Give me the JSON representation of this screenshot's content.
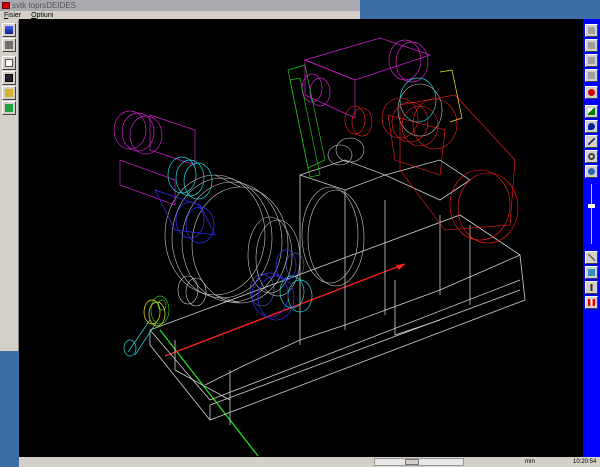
{
  "window": {
    "title": "svtk toprsDEIDES"
  },
  "menu": {
    "items": [
      "Fisier",
      "Optiuni"
    ]
  },
  "left_toolbar": {
    "buttons": [
      "view-icon",
      "shape-icon",
      "new-file-icon",
      "save-icon",
      "open-folder-icon",
      "exit-icon"
    ]
  },
  "right_toolbar": {
    "buttons": [
      "blank",
      "blank",
      "blank",
      "blank",
      "stop-icon",
      "graph-icon",
      "ink-drop-icon",
      "pen-icon",
      "zoom-icon",
      "rotate-icon",
      "check-icon",
      "brush-icon",
      "info-icon",
      "color-icon"
    ]
  },
  "status": {
    "units": "mm",
    "clock": "10:20:54"
  },
  "colors": {
    "viewport_bg": "#000000",
    "toolbar_accent": "#0000ff",
    "desktop": "#3a6ea5"
  }
}
